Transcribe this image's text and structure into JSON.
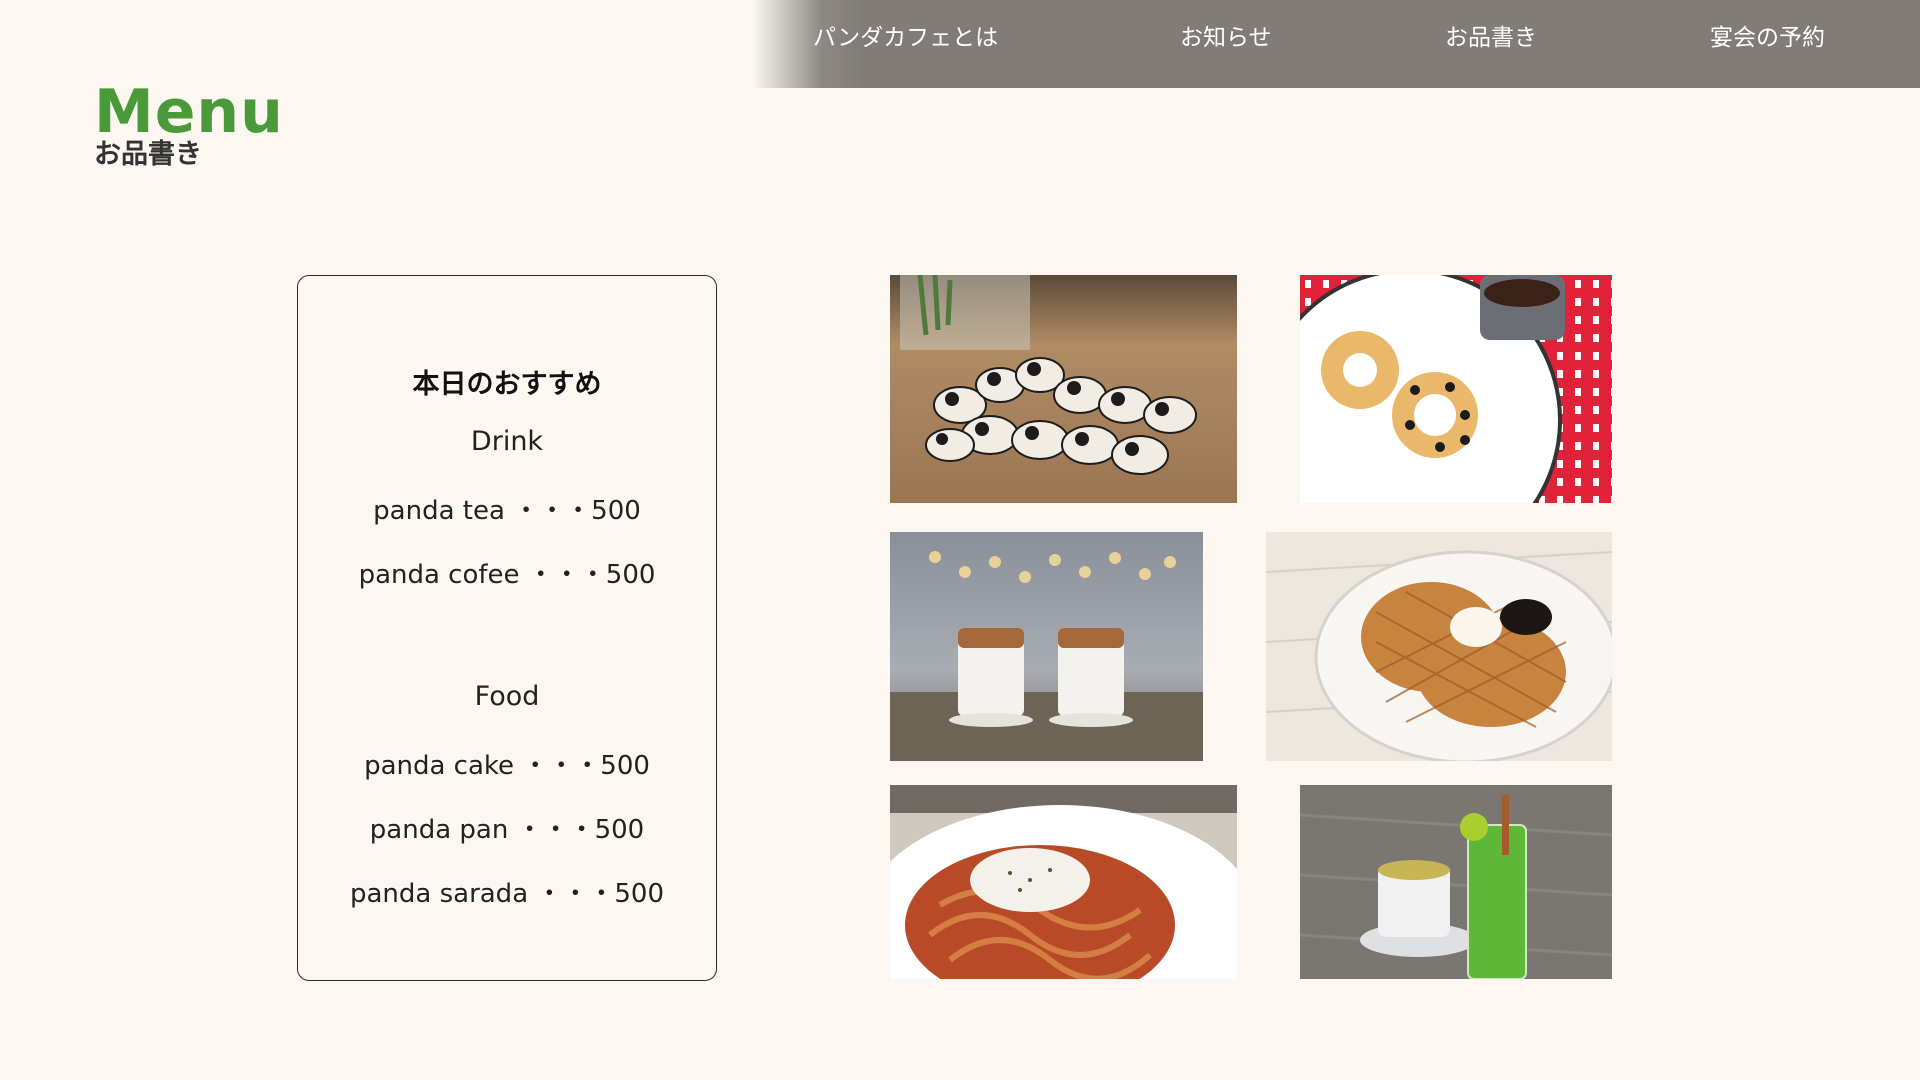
{
  "nav": {
    "items": [
      {
        "label": "パンダカフェとは"
      },
      {
        "label": "お知らせ"
      },
      {
        "label": "お品書き"
      },
      {
        "label": "宴会の予約"
      }
    ],
    "background": "#817c78",
    "text_color": "#ffffff"
  },
  "logo": {
    "main": "Menu",
    "sub": "お品書き",
    "main_color": "#4a9a3a"
  },
  "menu": {
    "title": "本日のおすすめ",
    "drink": {
      "heading": "Drink",
      "items": [
        {
          "text": "panda tea ・・・500"
        },
        {
          "text": "panda cofee ・・・500"
        }
      ]
    },
    "food": {
      "heading": "Food",
      "items": [
        {
          "text": "panda cake ・・・500"
        },
        {
          "text": "panda pan ・・・500"
        },
        {
          "text": "panda sarada ・・・500"
        }
      ]
    }
  },
  "photos": [
    {
      "subject": "panda-figurines"
    },
    {
      "subject": "panda-donuts"
    },
    {
      "subject": "layered-lattes"
    },
    {
      "subject": "waffle"
    },
    {
      "subject": "pasta"
    },
    {
      "subject": "green-tea-drinks"
    }
  ],
  "colors": {
    "page_background": "#fcf8f1",
    "card_border": "#2b2b2b"
  }
}
